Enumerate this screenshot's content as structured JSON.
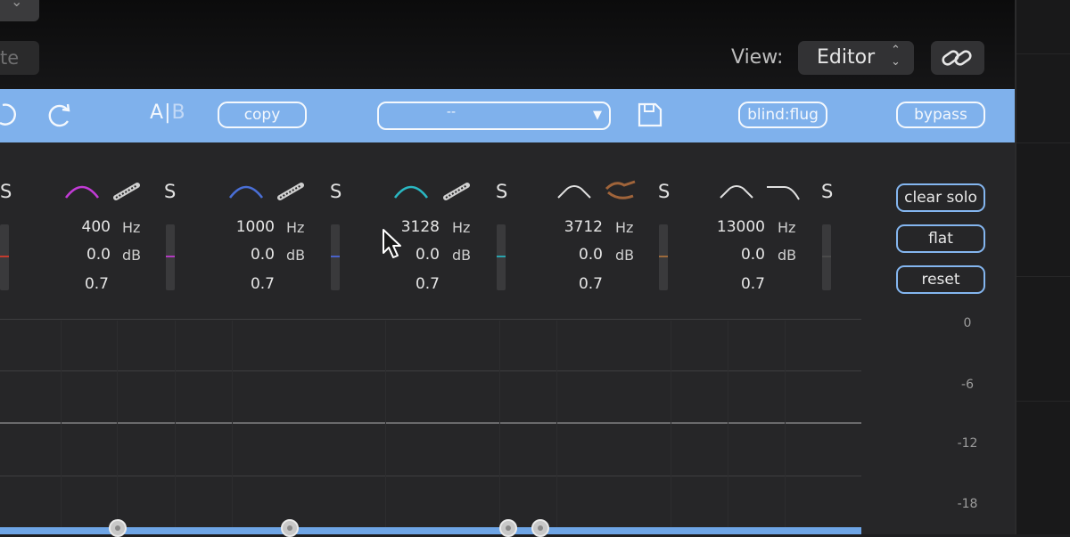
{
  "host": {
    "preset_field_text": "te",
    "corner_dropdown_glyph": "⌄",
    "view_label": "View:",
    "view_value": "Editor",
    "view_options_glyph": "⌃⌄",
    "link_icon": "link-icon"
  },
  "toolbar": {
    "undo_icon": "undo-icon",
    "redo_icon": "redo-icon",
    "ab_a": "A",
    "ab_sep": "|",
    "ab_b": "B",
    "copy_label": "copy",
    "preset_value": "--",
    "save_icon": "save-icon",
    "blindflug_label": "blind:flug",
    "bypass_label": "bypass"
  },
  "bands": [
    {
      "shape": "bell",
      "color": "#c23bd6",
      "freq": "400",
      "gain": "0.0",
      "q": "0.7",
      "meter_color": "#b23bc0"
    },
    {
      "shape": "bell",
      "color": "#4a6fd6",
      "freq": "1000",
      "gain": "0.0",
      "q": "0.7",
      "meter_color": "#4a62c9"
    },
    {
      "shape": "bell",
      "color": "#2ab7c2",
      "freq": "3128",
      "gain": "0.0",
      "q": "0.7",
      "meter_color": "#2aa3ad"
    },
    {
      "shape": "bell",
      "color": "#e0e0e0",
      "freq": "3712",
      "gain": "0.0",
      "q": "0.7",
      "meter_color": "#9c6a3c"
    },
    {
      "shape": "bell",
      "color": "#e0e0e0",
      "freq": "13000",
      "gain": "0.0",
      "q": "0.7",
      "meter_color": "#4a4a4a"
    }
  ],
  "first_meter_color": "#c23b2e",
  "labels": {
    "solo": "S",
    "hz": "Hz",
    "db": "dB"
  },
  "side_buttons": {
    "clear_solo": "clear solo",
    "flat": "flat",
    "reset": "reset"
  },
  "db_scale": [
    "0",
    "-6",
    "-12",
    "-18"
  ]
}
